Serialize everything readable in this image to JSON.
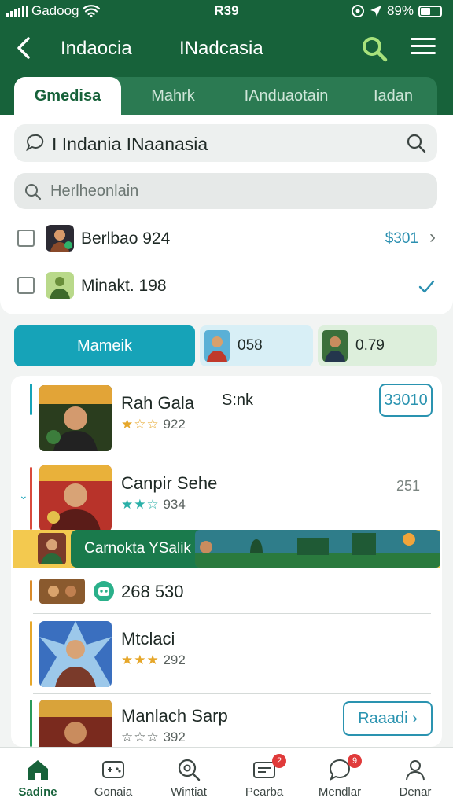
{
  "status": {
    "carrier": "Gadoog",
    "time": "R39",
    "battery": "89%"
  },
  "header": {
    "title_left": "Indaocia",
    "title_right": "INadcasia"
  },
  "tabs": [
    "Gmedisa",
    "Mahrk",
    "IAnduaotain",
    "Iadan"
  ],
  "search": {
    "query": "I Indania INaanasia",
    "placeholder": "Herlheonlain"
  },
  "checklist": [
    {
      "label": "Berlbao 924",
      "value": "$301"
    },
    {
      "label": "Minakt. 198",
      "value": ""
    }
  ],
  "filters": {
    "primary": "Mameik",
    "second_value": "058",
    "third_value": "0.79"
  },
  "items": [
    {
      "name": "Rah Gala",
      "tag": "S:nk",
      "rating": "922",
      "action": "33010",
      "stars": "★☆☆"
    },
    {
      "name": "Canpir Sehe",
      "rating": "934",
      "value": "251",
      "stars": "★★☆"
    },
    {
      "name": "",
      "rating": "268 530"
    },
    {
      "name": "Mtclaci",
      "rating": "292",
      "stars": "★★★"
    },
    {
      "name": "Manlach Sarp",
      "rating": "392",
      "action": "Raaadi",
      "stars": "☆☆☆"
    }
  ],
  "banner": {
    "label": "Carnokta YSalik"
  },
  "nav": [
    {
      "label": "Sadine",
      "icon": "home-icon",
      "active": true
    },
    {
      "label": "Gonaia",
      "icon": "gamepad-icon"
    },
    {
      "label": "Wintiat",
      "icon": "search-icon"
    },
    {
      "label": "Pearba",
      "icon": "mail-icon",
      "badge": "2"
    },
    {
      "label": "Mendlar",
      "icon": "chat-icon",
      "badge": "9"
    },
    {
      "label": "Denar",
      "icon": "profile-icon"
    }
  ],
  "colors": {
    "brand": "#17623a",
    "accent": "#16a3b8"
  }
}
